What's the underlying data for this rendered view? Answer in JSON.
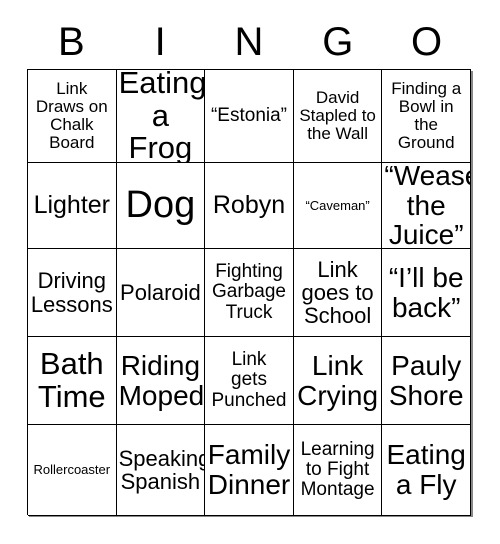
{
  "header": {
    "letters": [
      "B",
      "I",
      "N",
      "G",
      "O"
    ]
  },
  "grid": {
    "rows": [
      {
        "cells": [
          {
            "text": "Link\nDraws on\nChalk\nBoard",
            "size": "fs-md"
          },
          {
            "text": "Eating\na Frog",
            "size": "fs-4xl"
          },
          {
            "text": "“Estonia”",
            "size": "fs-lg"
          },
          {
            "text": "David\nStapled to\nthe Wall",
            "size": "fs-md"
          },
          {
            "text": "Finding a\nBowl in\nthe\nGround",
            "size": "fs-md"
          }
        ]
      },
      {
        "cells": [
          {
            "text": "Lighter",
            "size": "fs-2xl"
          },
          {
            "text": "Dog",
            "size": "fs-5xl"
          },
          {
            "text": "Robyn",
            "size": "fs-2xl"
          },
          {
            "text": "“Caveman”",
            "size": "fs-xs"
          },
          {
            "text": "“Wease\nthe\nJuice”",
            "size": "fs-3xl"
          }
        ]
      },
      {
        "cells": [
          {
            "text": "Driving\nLessons",
            "size": "fs-xl"
          },
          {
            "text": "Polaroid",
            "size": "fs-xl"
          },
          {
            "text": "Fighting\nGarbage\nTruck",
            "size": "fs-lg"
          },
          {
            "text": "Link\ngoes to\nSchool",
            "size": "fs-xl"
          },
          {
            "text": "“I’ll be\nback”",
            "size": "fs-3xl"
          }
        ]
      },
      {
        "cells": [
          {
            "text": "Bath\nTime",
            "size": "fs-4xl"
          },
          {
            "text": "Riding\nMoped",
            "size": "fs-3xl"
          },
          {
            "text": "Link\ngets\nPunched",
            "size": "fs-lg"
          },
          {
            "text": "Link\nCrying",
            "size": "fs-3xl"
          },
          {
            "text": "Pauly\nShore",
            "size": "fs-3xl"
          }
        ]
      },
      {
        "cells": [
          {
            "text": "Rollercoaster",
            "size": "fs-xs"
          },
          {
            "text": "Speaking\nSpanish",
            "size": "fs-xl"
          },
          {
            "text": "Family\nDinner",
            "size": "fs-3xl"
          },
          {
            "text": "Learning\nto Fight\nMontage",
            "size": "fs-lg"
          },
          {
            "text": "Eating\na Fly",
            "size": "fs-3xl"
          }
        ]
      }
    ]
  }
}
